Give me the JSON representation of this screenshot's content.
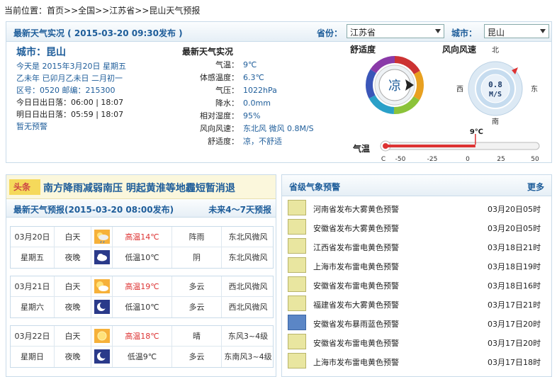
{
  "breadcrumb": {
    "prefix": "当前位置：",
    "items": [
      "首页",
      ">>全国",
      ">>江苏省",
      ">>昆山天气预报"
    ]
  },
  "current": {
    "header": "最新天气实况 ( 2015-03-20  09:30发布 )",
    "province_label": "省份：",
    "province": "江苏省",
    "city_label": "城市：",
    "city": "昆山",
    "info": {
      "city": "城市：昆山",
      "today": "今天是  2015年3月20日 星期五",
      "lunar": "乙未年 已卯月乙未日 二月初一",
      "code": "区号：0520  邮编：215300",
      "sun_today": "今日日出日落：06:00 | 18:07",
      "sun_tomorrow": "明日日出日落：05:59 | 18:07",
      "warning": "暂无预警"
    },
    "live_title": "最新天气实况",
    "live": [
      {
        "k": "气温：",
        "v": "9℃"
      },
      {
        "k": "体感温度：",
        "v": "6.3℃"
      },
      {
        "k": "气压：",
        "v": "1022hPa"
      },
      {
        "k": "降水：",
        "v": "0.0mm"
      },
      {
        "k": "相对湿度：",
        "v": "95%"
      },
      {
        "k": "风向风速：",
        "v": "东北风 微风 0.8M/S"
      },
      {
        "k": "舒适度：",
        "v": "凉，不舒适"
      }
    ],
    "comfort_title": "舒适度",
    "comfort_value": "凉",
    "wind_title": "风向风速",
    "wind_value": "0.8",
    "wind_unit": "M/S",
    "compass": {
      "n": "北",
      "s": "南",
      "e": "东",
      "w": "西"
    },
    "temp_title": "气温",
    "temp_value": "9℃",
    "temp_fraction": 0.59,
    "thermo_ticks": [
      "C",
      "-50",
      "-25",
      "0",
      "25",
      "50"
    ]
  },
  "forecast": {
    "headline_tag": "头条",
    "headline": "南方降雨减弱南压  明起黄淮等地霾短暂消退",
    "header": "最新天气预报(2015-03-20  08:00发布)",
    "more": "未来4～7天预报",
    "days": [
      {
        "date": "03月20日",
        "week": "星期五",
        "day": {
          "p": "白天",
          "icon": "sun-rain-icon",
          "t": "高温14℃",
          "w": "阵雨",
          "wind": "东北风微风"
        },
        "night": {
          "p": "夜晚",
          "icon": "cloud-night-icon",
          "t": "低温10℃",
          "w": "阴",
          "wind": "东北风微风"
        }
      },
      {
        "date": "03月21日",
        "week": "星期六",
        "day": {
          "p": "白天",
          "icon": "sun-cloud-icon",
          "t": "高温19℃",
          "w": "多云",
          "wind": "西北风微风"
        },
        "night": {
          "p": "夜晚",
          "icon": "moon-icon",
          "t": "低温10℃",
          "w": "多云",
          "wind": "西北风微风"
        }
      },
      {
        "date": "03月22日",
        "week": "星期日",
        "day": {
          "p": "白天",
          "icon": "sun-icon",
          "t": "高温18℃",
          "w": "晴",
          "wind": "东风3~4级"
        },
        "night": {
          "p": "夜晚",
          "icon": "moon-icon",
          "t": "低温9℃",
          "w": "多云",
          "wind": "东南风3~4级"
        }
      }
    ]
  },
  "alerts": {
    "header": "省级气象预警",
    "more": "更多",
    "items": [
      {
        "n": "河南省发布大雾黄色预警",
        "d": "03月20日05时"
      },
      {
        "n": "安徽省发布大雾黄色预警",
        "d": "03月20日05时"
      },
      {
        "n": "江西省发布雷电黄色预警",
        "d": "03月18日21时"
      },
      {
        "n": "上海市发布雷电黄色预警",
        "d": "03月18日19时"
      },
      {
        "n": "安徽省发布雷电黄色预警",
        "d": "03月18日16时"
      },
      {
        "n": "福建省发布大雾黄色预警",
        "d": "03月17日21时"
      },
      {
        "n": "安徽省发布暴雨蓝色预警",
        "d": "03月17日20时"
      },
      {
        "n": "安徽省发布雷电黄色预警",
        "d": "03月17日20时"
      },
      {
        "n": "上海市发布雷电黄色预警",
        "d": "03月17日18时"
      }
    ]
  }
}
